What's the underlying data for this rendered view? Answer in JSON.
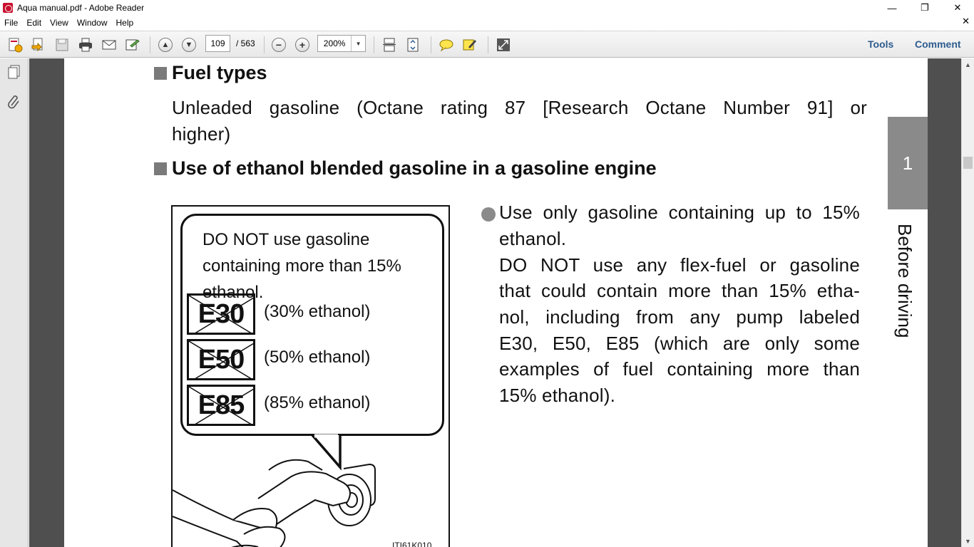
{
  "window": {
    "title": "Aqua manual.pdf - Adobe Reader",
    "controls": {
      "minimize": "—",
      "maximize": "❐",
      "close": "✕"
    }
  },
  "menu": {
    "items": [
      "File",
      "Edit",
      "View",
      "Window",
      "Help"
    ],
    "close_glyph": "✕"
  },
  "toolbar": {
    "page_current": "109",
    "page_total": "/ 563",
    "zoom": "200%",
    "tools_label": "Tools",
    "comment_label": "Comment"
  },
  "document": {
    "fuel_heading": "Fuel types",
    "fuel_body_line1": "Unleaded gasoline (Octane rating 87 [Research Octane Number 91] or",
    "fuel_body_line2": "higher)",
    "ethanol_heading": "Use of ethanol blended gasoline in a gasoline engine",
    "bubble_text": "DO NOT use gasoline containing more than 15% ethanol.",
    "labels": [
      {
        "code": "E30",
        "desc": "(30% ethanol)"
      },
      {
        "code": "E50",
        "desc": "(50% ethanol)"
      },
      {
        "code": "E85",
        "desc": "(85% ethanol)"
      }
    ],
    "illustration_code": "ITI61K010",
    "right_col": {
      "line1": "Use only gasoline containing up to 15%",
      "line2": "ethanol.",
      "line3": "DO NOT use any flex-fuel or gasoline",
      "line4": "that could contain more than 15% etha-",
      "line5": "nol, including from any pump labeled",
      "line6": "E30, E50, E85 (which are only some",
      "line7": "examples of fuel containing more than",
      "line8": "15% ethanol)."
    },
    "chapter_number": "1",
    "chapter_label": "Before driving"
  },
  "colors": {
    "toolbar_link": "#2d5b8e",
    "chapter_tab": "#8a8a8a",
    "heading_square": "#7a7a7a"
  }
}
